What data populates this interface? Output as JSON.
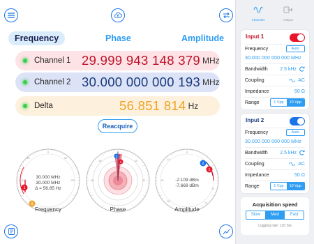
{
  "tabs": {
    "frequency": "Frequency",
    "phase": "Phase",
    "amplitude": "Amplitude"
  },
  "channels": [
    {
      "label": "Channel 1",
      "value": "29.999 943 148 379",
      "unit": "MHz",
      "color": "#c0122a",
      "bg": "#fde3e6"
    },
    {
      "label": "Channel 2",
      "value": "30.000 000 000 193",
      "unit": "MHz",
      "color": "#1a3b7c",
      "bg": "#dde3f7"
    },
    {
      "label": "Delta",
      "value": "56.851 814",
      "unit": "Hz",
      "color": "#f0a325",
      "bg": "#fdf0dc"
    }
  ],
  "reacquire": "Reacquire",
  "gauges": {
    "frequency": {
      "label": "Frequency",
      "line1": "30.000 MHz",
      "line2": "30.000 MHz",
      "line3": "Δ = 56.85 Hz",
      "ticks": [
        "0",
        "100",
        "80",
        "60",
        "40",
        "20",
        "-20",
        "-40",
        "-60",
        "-80",
        "-100"
      ],
      "markers": [
        "1",
        "Δ"
      ]
    },
    "phase": {
      "label": "Phase",
      "ticks": [
        "0",
        "45",
        "90",
        "135",
        "180",
        "-135",
        "-90",
        "-45"
      ],
      "markers": [
        "1",
        "2"
      ]
    },
    "amplitude": {
      "label": "Amplitude",
      "line1": "-2.109 dBm",
      "line2": "-7.669 dBm",
      "ticks": [
        "0",
        "-10",
        "-20",
        "-30",
        "-40",
        "-50",
        "-60",
        "10",
        "20"
      ],
      "markers": [
        "2",
        "1"
      ]
    }
  },
  "sidebar": {
    "tabs": [
      {
        "label": "Channels",
        "icon": "wave-icon"
      },
      {
        "label": "Output",
        "icon": "output-icon"
      }
    ],
    "input1": {
      "title": "Input 1",
      "toggle_color": "#e8162b",
      "frequency_label": "Frequency",
      "auto": "Auto",
      "frequency_value": "30.000 000 000 000 MHz",
      "bandwidth_label": "Bandwidth",
      "bandwidth_value": "2.5 kHz",
      "coupling_label": "Coupling",
      "coupling_value": "AC",
      "impedance_label": "Impedance",
      "impedance_value": "50 Ω",
      "range_label": "Range",
      "range_options": [
        "1 Vpp",
        "10 Vpp"
      ],
      "range_selected": "10 Vpp"
    },
    "input2": {
      "title": "Input 2",
      "toggle_color": "#1a73e8",
      "frequency_label": "Frequency",
      "auto": "Auto",
      "frequency_value": "30.000 000 000 000 MHz",
      "bandwidth_label": "Bandwidth",
      "bandwidth_value": "2.5 kHz",
      "coupling_label": "Coupling",
      "coupling_value": "AC",
      "impedance_label": "Impedance",
      "impedance_value": "50 Ω",
      "range_label": "Range",
      "range_options": [
        "1 Vpp",
        "10 Vpp"
      ],
      "range_selected": "10 Vpp"
    },
    "acquisition": {
      "title": "Acquisition speed",
      "options": [
        "Slow",
        "Med",
        "Fast"
      ],
      "selected": "Med",
      "logging": "Logging rate: 120 S/s"
    }
  },
  "colors": {
    "accent": "#2e9df2",
    "red": "#e8162b",
    "navy": "#1a3b7c",
    "orange": "#f0a325"
  }
}
